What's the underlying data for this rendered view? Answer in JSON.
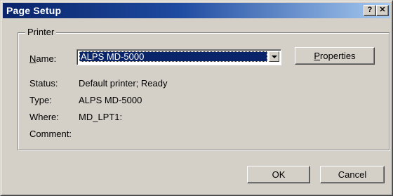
{
  "window": {
    "title": "Page Setup",
    "help_button": "?",
    "close_button": "✕"
  },
  "printer_group": {
    "legend": "Printer",
    "name_label_prefix": "N",
    "name_label_rest": "ame:",
    "name_value": "ALPS MD-5000",
    "properties_prefix": "P",
    "properties_rest": "roperties",
    "status_label": "Status:",
    "status_value": "Default printer; Ready",
    "type_label": "Type:",
    "type_value": "ALPS MD-5000",
    "where_label": "Where:",
    "where_value": "MD_LPT1:",
    "comment_label": "Comment:",
    "comment_value": ""
  },
  "buttons": {
    "ok": "OK",
    "cancel": "Cancel"
  },
  "colors": {
    "titlebar_start": "#0a246a",
    "titlebar_end": "#a6caf0",
    "dialog_face": "#d4d0c8",
    "selection": "#0a246a"
  }
}
